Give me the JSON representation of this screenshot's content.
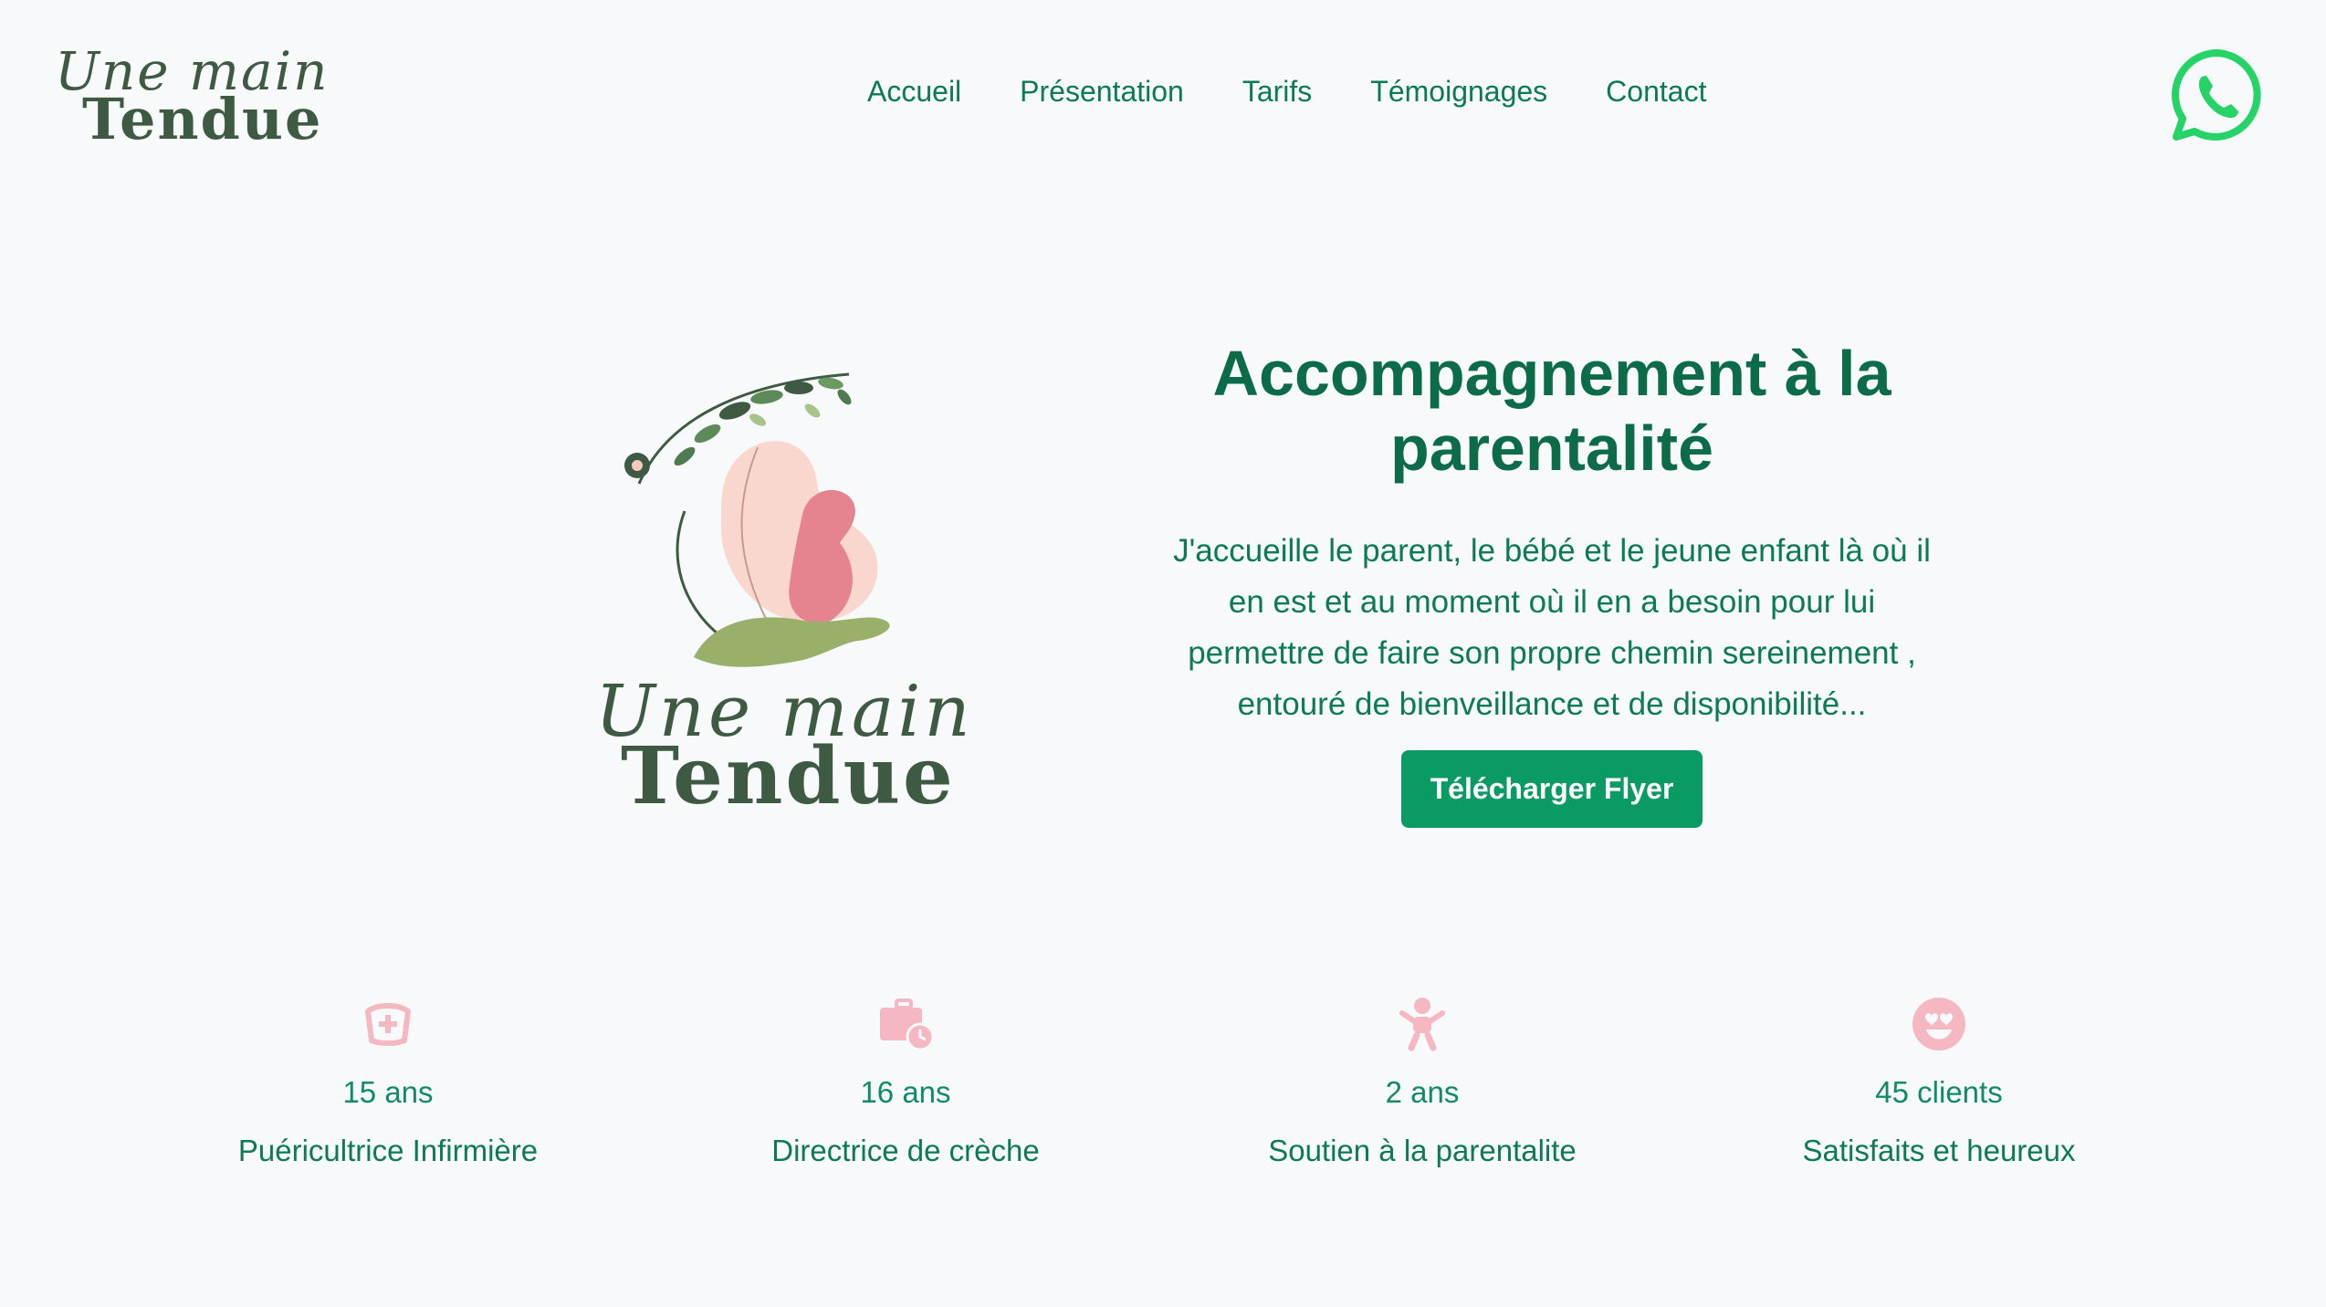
{
  "brand": {
    "script": "Une main",
    "bold": "Tendue"
  },
  "nav": {
    "items": [
      {
        "label": "Accueil"
      },
      {
        "label": "Présentation"
      },
      {
        "label": "Tarifs"
      },
      {
        "label": "Témoignages"
      },
      {
        "label": "Contact"
      }
    ]
  },
  "hero": {
    "title": "Accompagnement à la parentalité",
    "description": "J'accueille le parent, le bébé et le jeune enfant là où il en est et au moment où il en a besoin pour lui permettre de faire son propre chemin sereinement , entouré de bienveillance et de disponibilité...",
    "cta_label": "Télécharger Flyer"
  },
  "stats": [
    {
      "icon": "nurse-cap-icon",
      "value": "15 ans",
      "label": "Puéricultrice Infirmière"
    },
    {
      "icon": "briefcase-clock-icon",
      "value": "16 ans",
      "label": "Directrice de crèche"
    },
    {
      "icon": "baby-icon",
      "value": "2 ans",
      "label": "Soutien à la parentalite"
    },
    {
      "icon": "smiley-heart-eyes-icon",
      "value": "45 clients",
      "label": "Satisfaits et heureux"
    }
  ],
  "colors": {
    "primary": "#0c7a55",
    "title": "#0c6b48",
    "button": "#0a9a63",
    "icon_pink": "#f5b7c2",
    "whatsapp": "#25d366",
    "background": "#f7f9fb"
  }
}
